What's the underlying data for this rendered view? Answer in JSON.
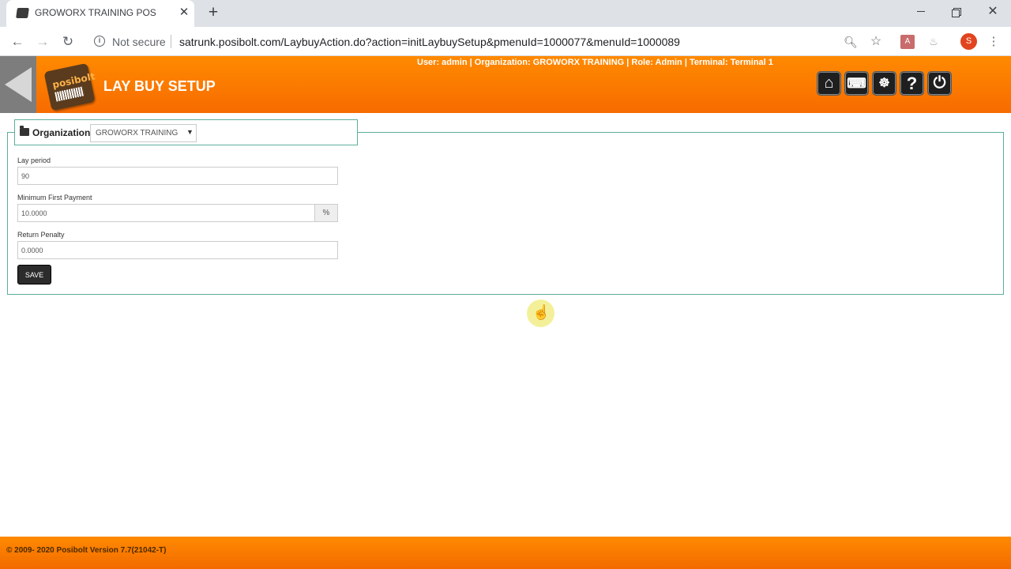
{
  "browser": {
    "tab_title": "GROWORX TRAINING POS",
    "tab_close": "✕",
    "new_tab": "+",
    "security_label": "Not secure",
    "url": "satrunk.posibolt.com/LaybuyAction.do?action=initLaybuySetup&pmenuId=1000077&menuId=1000089",
    "profile_initial": "S",
    "window_close": "✕"
  },
  "header": {
    "title": "LAY BUY SETUP",
    "logo_text": "posibolt",
    "user_info": "User: admin | Organization: GROWORX TRAINING | Role: Admin | Terminal: Terminal 1",
    "buttons": [
      {
        "name": "home",
        "icon": "home-icon"
      },
      {
        "name": "keyboard",
        "icon": "keyboard-icon"
      },
      {
        "name": "support",
        "icon": "support-icon"
      },
      {
        "name": "help",
        "icon": "help-icon"
      },
      {
        "name": "logout",
        "icon": "power-icon"
      }
    ]
  },
  "form": {
    "organization_label": "Organization",
    "organization_value": "GROWORX TRAINING",
    "lay_period_label": "Lay period",
    "lay_period_value": "90",
    "min_first_payment_label": "Minimum First Payment",
    "min_first_payment_value": "10.0000",
    "min_first_payment_unit": "%",
    "return_penalty_label": "Return Penalty",
    "return_penalty_value": "0.0000",
    "save_label": "SAVE"
  },
  "footer": {
    "text": "© 2009- 2020 Posibolt Version  7.7(21042-T)"
  },
  "colors": {
    "header_orange": "#ff8a00",
    "panel_border": "#5cae9b",
    "button_dark": "#2b2b2b"
  }
}
